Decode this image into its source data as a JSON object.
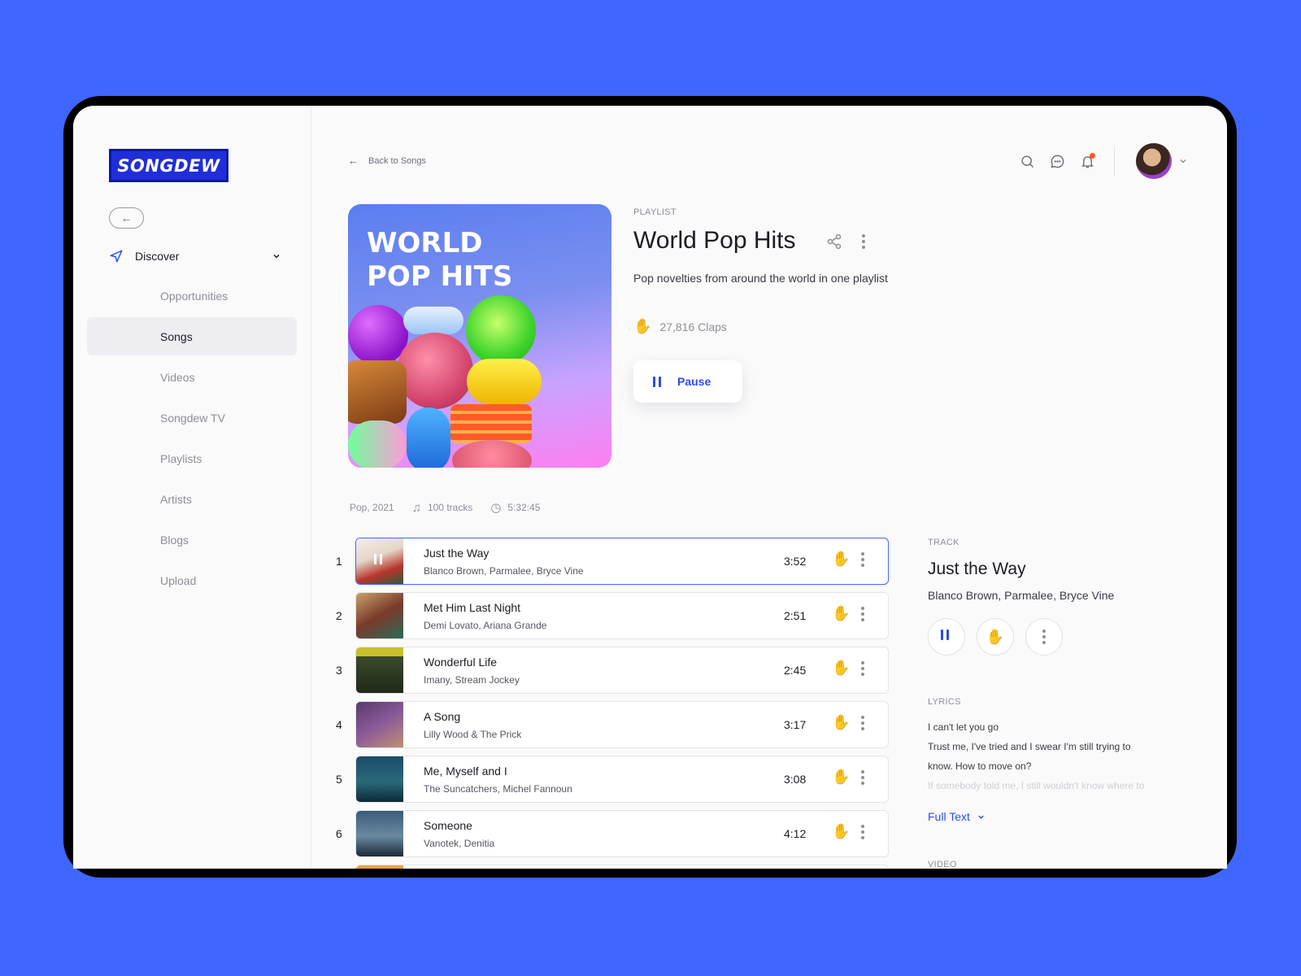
{
  "app": {
    "logo_text": "SONGDEW",
    "brand_color": "#1f2ed8",
    "accent": "#3f66ff"
  },
  "sidebar": {
    "discover_label": "Discover",
    "items": [
      {
        "label": "Opportunities",
        "active": false
      },
      {
        "label": "Songs",
        "active": true
      },
      {
        "label": "Videos",
        "active": false
      },
      {
        "label": "Songdew TV",
        "active": false
      },
      {
        "label": "Playlists",
        "active": false
      },
      {
        "label": "Artists",
        "active": false
      },
      {
        "label": "Blogs",
        "active": false
      },
      {
        "label": "Upload",
        "active": false
      }
    ]
  },
  "header": {
    "back_label": "Back to Songs",
    "icons": [
      "search-icon",
      "chat-icon",
      "bell-icon",
      "avatar",
      "chevron-down-icon"
    ]
  },
  "playlist": {
    "cover_line1": "WORLD",
    "cover_line2": "POP HITS",
    "eyebrow": "PLAYLIST",
    "title": "World Pop Hits",
    "description": "Pop novelties from around the world in one playlist",
    "claps": "27,816 Claps",
    "pause_label": "Pause",
    "genre_year": "Pop, 2021",
    "tracks_count": "100 tracks",
    "duration": "5:32:45"
  },
  "tracks": [
    {
      "num": "1",
      "title": "Just the Way",
      "artist": "Blanco Brown, Parmalee, Bryce Vine",
      "duration": "3:52",
      "clapped": true,
      "playing": true
    },
    {
      "num": "2",
      "title": "Met Him Last Night",
      "artist": "Demi Lovato, Ariana Grande",
      "duration": "2:51",
      "clapped": true,
      "playing": false
    },
    {
      "num": "3",
      "title": "Wonderful Life",
      "artist": "Imany, Stream Jockey",
      "duration": "2:45",
      "clapped": false,
      "playing": false
    },
    {
      "num": "4",
      "title": "A Song",
      "artist": "Lilly Wood & The Prick",
      "duration": "3:17",
      "clapped": false,
      "playing": false
    },
    {
      "num": "5",
      "title": "Me, Myself and I",
      "artist": "The Suncatchers, Michel Fannoun",
      "duration": "3:08",
      "clapped": false,
      "playing": false
    },
    {
      "num": "6",
      "title": "Someone",
      "artist": "Vanotek, Denitia",
      "duration": "4:12",
      "clapped": false,
      "playing": false
    }
  ],
  "track_panel": {
    "eyebrow": "TRACK",
    "title": "Just the Way",
    "artist": "Blanco Brown, Parmalee, Bryce Vine",
    "lyrics_label": "LYRICS",
    "lyrics": [
      "I can't let you go",
      "Trust me, I've tried and I swear I'm still trying to",
      "know. How to move on?",
      "If somebody told me, I still wouldn't know where to"
    ],
    "full_text_label": "Full Text",
    "next_section_label": "VIDEO"
  }
}
